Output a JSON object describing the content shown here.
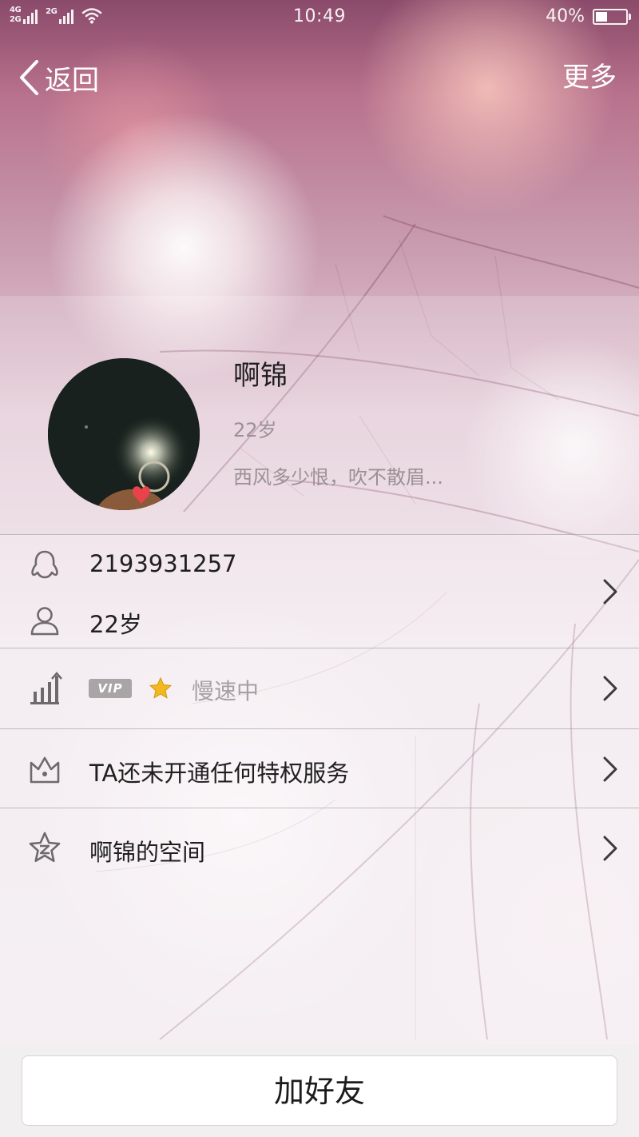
{
  "status_bar": {
    "network_primary": "4G",
    "network_secondary": "2G",
    "network_sim2": "2G",
    "time": "10:49",
    "battery_text": "40%",
    "battery_level": 0.4
  },
  "nav": {
    "back_label": "返回",
    "more_label": "更多"
  },
  "profile": {
    "name": "啊锦",
    "age": "22岁",
    "signature": "西风多少恨，吹不散眉..."
  },
  "details": {
    "qq_number": "2193931257",
    "age": "22岁",
    "vip_badge": "VIP",
    "vip_status": "慢速中",
    "privilege_text": "TA还未开通任何特权服务",
    "space_text": "啊锦的空间"
  },
  "actions": {
    "add_friend_label": "加好友"
  },
  "icons": {
    "back": "chevron-left-icon",
    "qq": "penguin-icon",
    "person": "person-icon",
    "level": "growth-chart-icon",
    "privilege": "crown-icon",
    "space": "star-z-icon",
    "vip_star": "star-icon",
    "arrow": "chevron-right-icon"
  },
  "colors": {
    "text_primary": "#1f1f1f",
    "text_secondary": "#9a9096",
    "vip_badge_bg": "#a9a5a7",
    "star": "#f2b91f"
  }
}
